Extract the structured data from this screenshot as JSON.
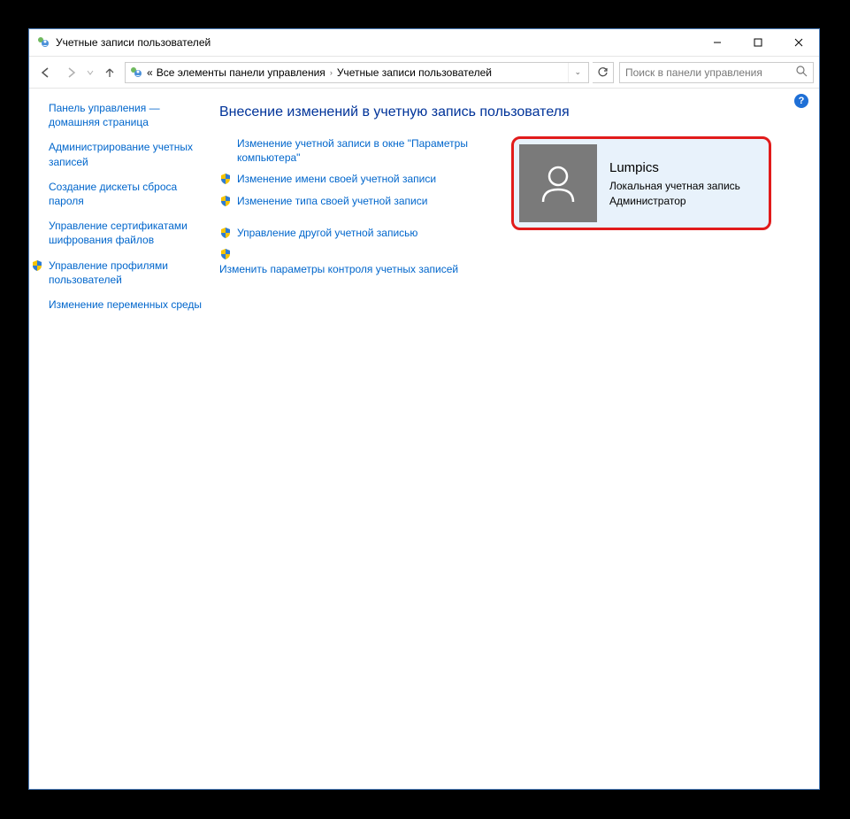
{
  "window": {
    "title": "Учетные записи пользователей"
  },
  "nav": {
    "breadcrumb_prefix": "«",
    "crumb1": "Все элементы панели управления",
    "crumb2": "Учетные записи пользователей"
  },
  "search": {
    "placeholder": "Поиск в панели управления"
  },
  "sidebar": {
    "items": [
      {
        "label": "Панель управления — домашняя страница",
        "shield": false
      },
      {
        "label": "Администрирование учетных записей",
        "shield": false
      },
      {
        "label": "Создание дискеты сброса пароля",
        "shield": false
      },
      {
        "label": "Управление сертификатами шифрования файлов",
        "shield": false
      },
      {
        "label": "Управление профилями пользователей",
        "shield": true
      },
      {
        "label": "Изменение переменных среды",
        "shield": false
      }
    ]
  },
  "main": {
    "heading": "Внесение изменений в учетную запись пользователя",
    "group1": [
      {
        "label": "Изменение учетной записи в окне \"Параметры компьютера\"",
        "shield": false
      },
      {
        "label": "Изменение имени своей учетной записи",
        "shield": true
      },
      {
        "label": "Изменение типа своей учетной записи",
        "shield": true
      }
    ],
    "group2": [
      {
        "label": "Управление другой учетной записью",
        "shield": true
      },
      {
        "label": "Изменить параметры контроля учетных записей",
        "shield": true,
        "shield_below": false
      }
    ]
  },
  "user": {
    "name": "Lumpics",
    "type": "Локальная учетная запись",
    "role": "Администратор"
  }
}
